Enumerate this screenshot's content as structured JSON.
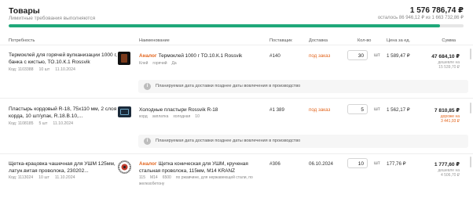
{
  "header": {
    "title": "Товары",
    "subtitle": "Лимитные требования выполняются",
    "total": "1 576 786,74 ₽",
    "remain": "осталось 86 946,12 ₽ из 1 663 732,86 ₽",
    "progress_fraction": 0.948
  },
  "columns": {
    "need": "Потребность",
    "name": "Наименование",
    "supplier": "Поставщик",
    "delivery": "Доставка",
    "qty": "Кол-во",
    "price": "Цена за ед.",
    "sum": "Сумма"
  },
  "rows": [
    {
      "need": "Термоклей для горячей вулканизации 1000 г, банка с кистью, ТО.10.К.1 Rossvik",
      "code": "Код: 1103388",
      "qty_meta": "10 шт",
      "date": "11.10.2024",
      "analog": "Аналог",
      "name": "Термоклей 1000 г ТО.10.К.1 Rossvik",
      "tags": [
        "Клей",
        "горячий",
        "Да"
      ],
      "supplier": "#140",
      "delivery": "под заказ",
      "qty": "30",
      "unit": "шт",
      "price": "1 589,47 ₽",
      "sum": "47 684,10 ₽",
      "sum_note1": "дешевле на",
      "sum_note2": "15 539,70 ₽",
      "thumb_color": "#7a3a1c"
    },
    {
      "need": "Пластырь кордовый R-18, 75х110 мм, 2 слоя корда, 10 шт/упак, R.18.В.10,...",
      "code": "Код: 1108185",
      "qty_meta": "5 шт",
      "date": "11.10.2024",
      "analog": "",
      "name": "Холодные пластыри Rossvik R-18",
      "tags": [
        "корд",
        "заплатка",
        "холодная",
        "10"
      ],
      "supplier": "#1 389",
      "delivery": "под заказ",
      "qty": "5",
      "unit": "шт",
      "price": "1 562,17 ₽",
      "sum": "7 810,85 ₽",
      "sum_note1": "дороже на",
      "sum_note2": "3 441,93 ₽",
      "thumb_color": "#1b2a3a"
    },
    {
      "need": "Щетка-крацовка чашечная для УШМ 125мм, латун.витая проволока, 230202...",
      "code": "Код: 1113024",
      "qty_meta": "10 шт",
      "date": "11.10.2024",
      "analog": "Аналог",
      "name": "Щетка коническая для УШМ, крученая стальная проволока, 115мм, М14 KRANZ",
      "tags": [
        "115",
        "М14",
        "6500",
        "по ржавчине, для нержавеющей стали, по железобетону"
      ],
      "supplier": "#306",
      "delivery": "06.10.2024",
      "qty": "10",
      "unit": "шт",
      "price": "177,76 ₽",
      "sum": "1 777,60 ₽",
      "sum_note1": "дешевле на",
      "sum_note2": "4 506,70 ₽",
      "thumb_color": "#c0392b"
    }
  ],
  "notice": "Планируемая дата доставки позднее даты вовлечения в производство",
  "colors": {
    "accent": "#1fa87a",
    "orange": "#e3661f"
  }
}
